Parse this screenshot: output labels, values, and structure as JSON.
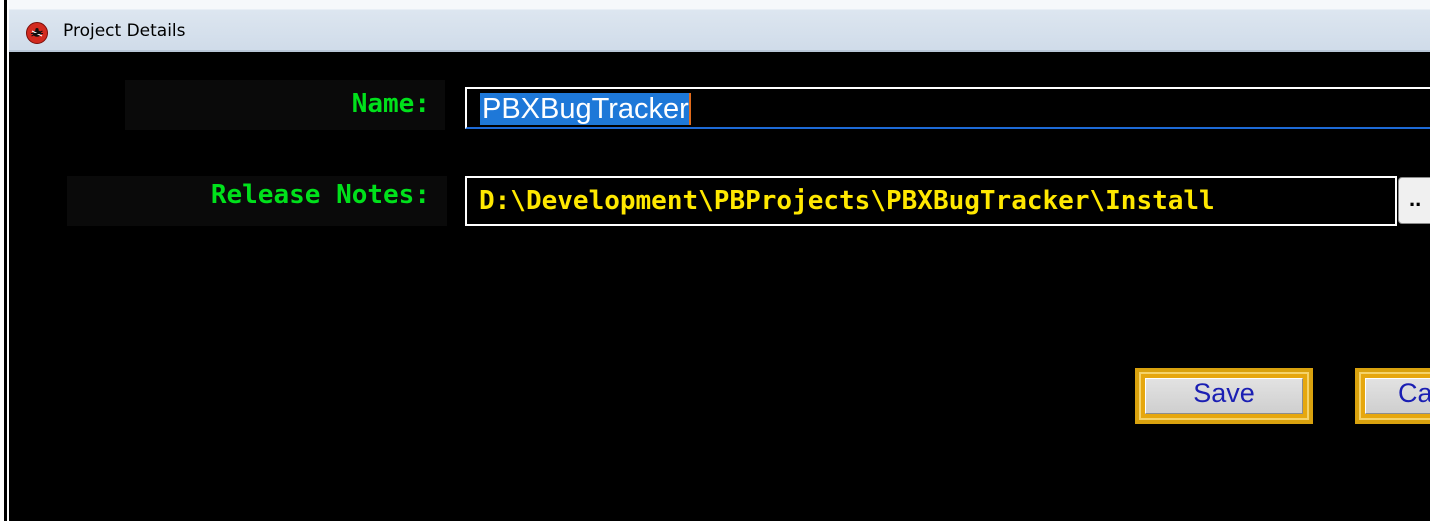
{
  "window": {
    "title": "Project Details",
    "icon": "bug-app-icon"
  },
  "form": {
    "name_label": "Name:",
    "name_value": "PBXBugTracker",
    "release_notes_label": "Release Notes:",
    "release_notes_value": "D:\\Development\\PBProjects\\PBXBugTracker\\Install",
    "browse_label": ".."
  },
  "buttons": {
    "save_label": "Save",
    "cancel_label": "Cancel"
  },
  "colors": {
    "background": "#000000",
    "label_green": "#00e11b",
    "value_yellow": "#ffe800",
    "selection_blue": "#1e78d8",
    "button_gold": "#e6a70e",
    "button_text_blue": "#1b1fb3"
  }
}
